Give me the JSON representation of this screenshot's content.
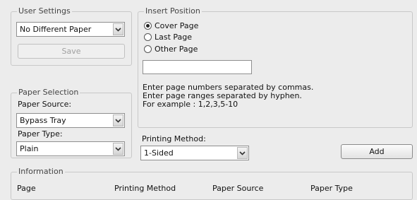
{
  "user_settings": {
    "legend": "User Settings",
    "selected": "No Different Paper",
    "save_label": "Save"
  },
  "insert_position": {
    "legend": "Insert Position",
    "options": [
      {
        "label": "Cover Page",
        "checked": true
      },
      {
        "label": "Last Page",
        "checked": false
      },
      {
        "label": "Other Page",
        "checked": false
      }
    ],
    "page_numbers_value": "",
    "help_lines": [
      "Enter page numbers separated by commas.",
      "Enter page ranges separated by hyphen.",
      "For example :  1,2,3,5-10"
    ]
  },
  "paper_selection": {
    "legend": "Paper Selection",
    "source_label": "Paper Source:",
    "source_value": "Bypass Tray",
    "type_label": "Paper Type:",
    "type_value": "Plain"
  },
  "printing_method": {
    "label": "Printing Method:",
    "value": "1-Sided"
  },
  "add_label": "Add",
  "information": {
    "legend": "Information",
    "columns": [
      "Page",
      "Printing Method",
      "Paper Source",
      "Paper Type"
    ]
  },
  "icons": {
    "dropdown": "chevron-down-icon"
  }
}
